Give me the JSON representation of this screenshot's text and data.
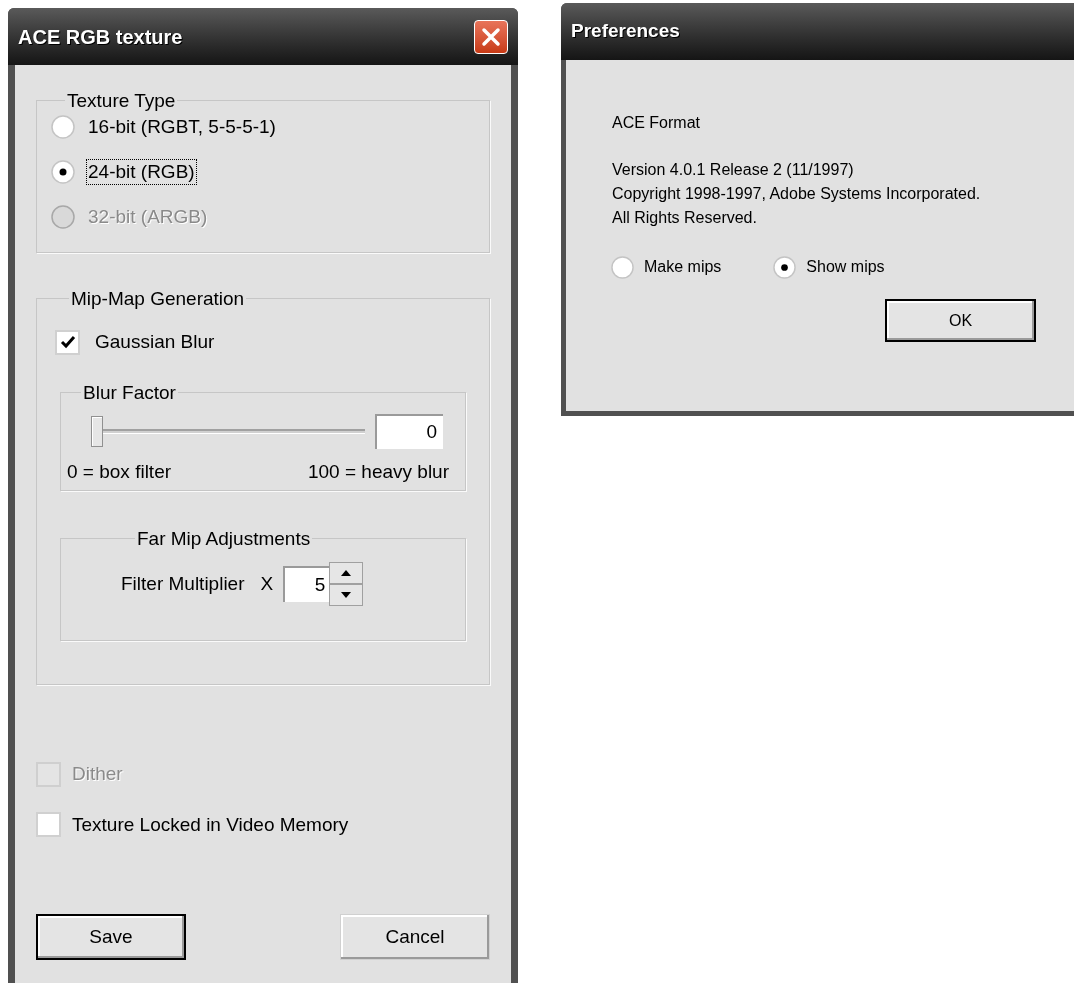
{
  "texture_dialog": {
    "title": "ACE RGB texture",
    "texture_type": {
      "legend": "Texture Type",
      "options": [
        {
          "label": "16-bit (RGBT, 5-5-5-1)",
          "selected": false,
          "disabled": false,
          "focused": false
        },
        {
          "label": "24-bit (RGB)",
          "selected": true,
          "disabled": false,
          "focused": true
        },
        {
          "label": "32-bit (ARGB)",
          "selected": false,
          "disabled": true,
          "focused": false
        }
      ]
    },
    "mip_map": {
      "legend": "Mip-Map Generation",
      "gaussian_blur": {
        "label": "Gaussian Blur",
        "checked": true
      },
      "blur_factor": {
        "legend": "Blur Factor",
        "level": 0,
        "value": "0",
        "min_label": "0 = box filter",
        "max_label": "100 = heavy blur"
      },
      "far_mip": {
        "legend": "Far Mip Adjustments",
        "label": "Filter Multiplier",
        "times": "X",
        "value": "5"
      }
    },
    "options": [
      {
        "label": "Dither",
        "checked": false,
        "disabled": true
      },
      {
        "label": "Texture Locked in Video Memory",
        "checked": false,
        "disabled": false
      }
    ],
    "buttons": [
      {
        "label": "Save",
        "default": true
      },
      {
        "label": "Cancel",
        "default": false
      }
    ]
  },
  "preferences_dialog": {
    "title": "Preferences",
    "heading": "ACE Format",
    "lines": [
      "Version 4.0.1 Release 2 (11/1997)",
      "Copyright 1998-1997, Adobe Systems Incorporated.",
      "All Rights Reserved."
    ],
    "radios": [
      {
        "label": "Make mips",
        "selected": false
      },
      {
        "label": "Show mips",
        "selected": true
      }
    ],
    "button": {
      "label": "OK",
      "default": true
    }
  }
}
